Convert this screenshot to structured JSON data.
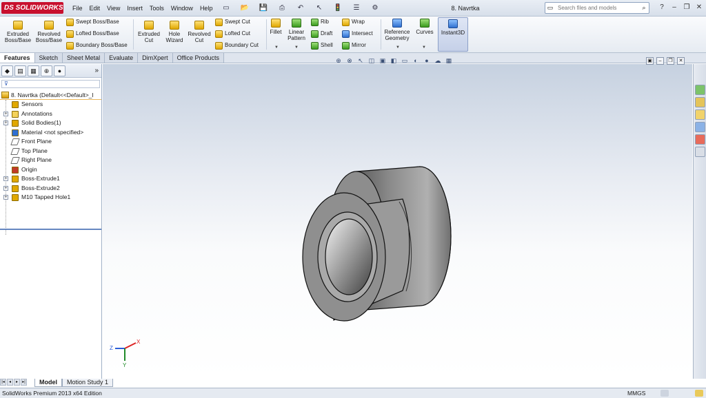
{
  "app": {
    "logo": "DS SOLIDWORKS",
    "document_title": "8. Navrtka"
  },
  "menu": [
    "File",
    "Edit",
    "View",
    "Insert",
    "Tools",
    "Window",
    "Help"
  ],
  "search": {
    "placeholder": "Search files and models"
  },
  "ribbon": {
    "extruded_boss": "Extruded Boss/Base",
    "revolved_boss": "Revolved Boss/Base",
    "swept_boss": "Swept Boss/Base",
    "lofted_boss": "Lofted Boss/Base",
    "boundary_boss": "Boundary Boss/Base",
    "extruded_cut": "Extruded Cut",
    "hole_wizard": "Hole Wizard",
    "revolved_cut": "Revolved Cut",
    "swept_cut": "Swept Cut",
    "lofted_cut": "Lofted Cut",
    "boundary_cut": "Boundary Cut",
    "fillet": "Fillet",
    "linear_pattern": "Linear Pattern",
    "rib": "Rib",
    "draft": "Draft",
    "shell": "Shell",
    "wrap": "Wrap",
    "intersect": "Intersect",
    "mirror": "Mirror",
    "reference_geometry": "Reference Geometry",
    "curves": "Curves",
    "instant3d": "Instant3D"
  },
  "command_tabs": [
    "Features",
    "Sketch",
    "Sheet Metal",
    "Evaluate",
    "DimXpert",
    "Office Products"
  ],
  "feature_tree": {
    "root": "8. Navrtka  (Default<<Default>_I",
    "items": [
      {
        "label": "Sensors",
        "expand": false,
        "icon": "sensor-icon"
      },
      {
        "label": "Annotations",
        "expand": true,
        "icon": "annotations-icon"
      },
      {
        "label": "Solid Bodies(1)",
        "expand": true,
        "icon": "solid-bodies-icon"
      },
      {
        "label": "Material <not specified>",
        "expand": false,
        "icon": "material-icon"
      },
      {
        "label": "Front Plane",
        "expand": false,
        "icon": "plane-icon"
      },
      {
        "label": "Top Plane",
        "expand": false,
        "icon": "plane-icon"
      },
      {
        "label": "Right Plane",
        "expand": false,
        "icon": "plane-icon"
      },
      {
        "label": "Origin",
        "expand": false,
        "icon": "origin-icon"
      },
      {
        "label": "Boss-Extrude1",
        "expand": true,
        "icon": "extrude-icon"
      },
      {
        "label": "Boss-Extrude2",
        "expand": true,
        "icon": "extrude-icon"
      },
      {
        "label": "M10 Tapped Hole1",
        "expand": true,
        "icon": "hole-icon"
      }
    ]
  },
  "bottom_tabs": [
    "Model",
    "Motion Study 1"
  ],
  "status": {
    "edition": "SolidWorks Premium 2013 x64 Edition",
    "units": "MMGS"
  },
  "triad": {
    "x": "X",
    "y": "Y",
    "z": "Z"
  }
}
